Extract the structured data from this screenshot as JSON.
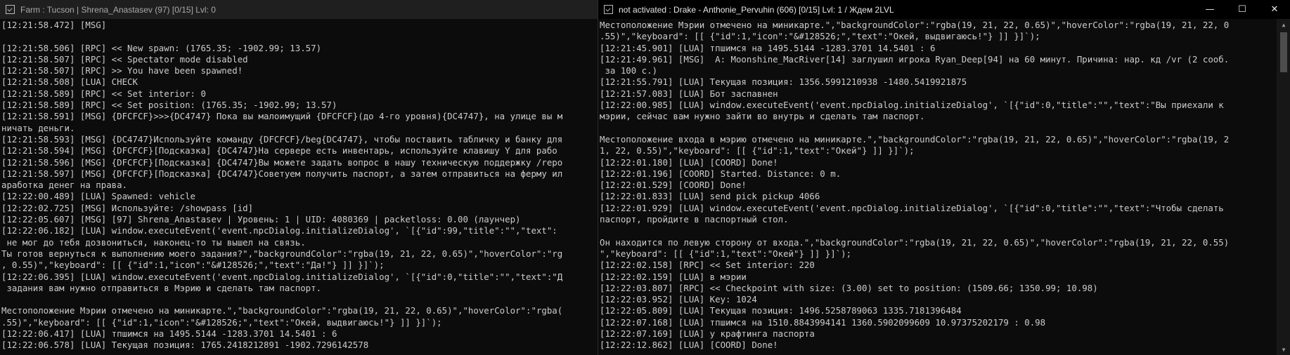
{
  "left_window": {
    "title": "Farm : Tucson | Shrena_Anastasev (97) [0/15] Lvl: 0",
    "lines": [
      "[12:21:58.472] [MSG]",
      "",
      "[12:21:58.506] [RPC] << New spawn: (1765.35; -1902.99; 13.57)",
      "[12:21:58.507] [RPC] << Spectator mode disabled",
      "[12:21:58.507] [RPC] >> You have been spawned!",
      "[12:21:58.508] [LUA] CHECK",
      "[12:21:58.589] [RPC] << Set interior: 0",
      "[12:21:58.589] [RPC] << Set position: (1765.35; -1902.99; 13.57)",
      "[12:21:58.591] [MSG] {DFCFCF}>>>{DC4747} Пока вы малоимущий {DFCFCF}(до 4-го уровня){DC4747}, на улице вы м",
      "ничать деньги.",
      "[12:21:58.593] [MSG] {DC4747}Используйте команду {DFCFCF}/beg{DC4747}, чтобы поставить табличку и банку для",
      "[12:21:58.594] [MSG] {DFCFCF}[Подсказка] {DC4747}На сервере есть инвентарь, используйте клавишу Y для рабо",
      "[12:21:58.596] [MSG] {DFCFCF}[Подсказка] {DC4747}Вы можете задать вопрос в нашу техническую поддержку /repo",
      "[12:21:58.597] [MSG] {DFCFCF}[Подсказка] {DC4747}Советуем получить паспорт, а затем отправиться на ферму ил",
      "аработка денег на права.",
      "[12:22:00.489] [LUA] Spawned: vehicle",
      "[12:22:02.725] [MSG] Используйте: /showpass [id]",
      "[12:22:05.607] [MSG] [97] Shrena_Anastasev | Уровень: 1 | UID: 4080369 | packetloss: 0.00 (лаунчер)",
      "[12:22:06.182] [LUA] window.executeEvent('event.npcDialog.initializeDialog', `[{\"id\":99,\"title\":\"\",\"text\":",
      " не мог до тебя дозвониться, наконец-то ты вышел на связь.",
      "Ты готов вернуться к выполнению моего задания?\",\"backgroundColor\":\"rgba(19, 21, 22, 0.65)\",\"hoverColor\":\"rg",
      ", 0.55)\",\"keyboard\": [[ {\"id\":1,\"icon\":\"&#128526;\",\"text\":\"Да!\"} ]] }]`);",
      "[12:22:06.395] [LUA] window.executeEvent('event.npcDialog.initializeDialog', `[{\"id\":0,\"title\":\"\",\"text\":\"Д",
      " задания вам нужно отправиться в Мэрию и сделать там паспорт.",
      "",
      "Местоположение Мэрии отмечено на миникарте.\",\"backgroundColor\":\"rgba(19, 21, 22, 0.65)\",\"hoverColor\":\"rgba(",
      ".55)\",\"keyboard\": [[ {\"id\":1,\"icon\":\"&#128526;\",\"text\":\"Окей, выдвигаюсь!\"} ]] }]`);",
      "[12:22:06.417] [LUA] тпшимся на 1495.5144 -1283.3701 14.5401 : 6",
      "[12:22:06.578] [LUA] Текущая позиция: 1765.2418212891 -1902.7296142578"
    ]
  },
  "right_window": {
    "title": "not activated : Drake - Anthonie_Pervuhin (606) [0/15] Lvl: 1 / Ждем 2LVL",
    "controls": {
      "minimize": "—",
      "maximize": "☐",
      "close": "✕"
    },
    "scroll_up": "▲",
    "scroll_down": "▼",
    "lines": [
      "Местоположение Мэрии отмечено на миникарте.\",\"backgroundColor\":\"rgba(19, 21, 22, 0.65)\",\"hoverColor\":\"rgba(19, 21, 22, 0",
      ".55)\",\"keyboard\": [[ {\"id\":1,\"icon\":\"&#128526;\",\"text\":\"Окей, выдвигаюсь!\"} ]] }]`);",
      "[12:21:45.901] [LUA] тпшимся на 1495.5144 -1283.3701 14.5401 : 6",
      "[12:21:49.961] [MSG]  A: Moonshine_MacRiver[14] заглушил игрока Ryan_Deep[94] на 60 минут. Причина: нар. кд /vr (2 сооб.",
      " за 100 с.)",
      "[12:21:55.791] [LUA] Текущая позиция: 1356.5991210938 -1480.5419921875",
      "[12:21:57.083] [LUA] Бот заспавнен",
      "[12:22:00.985] [LUA] window.executeEvent('event.npcDialog.initializeDialog', `[{\"id\":0,\"title\":\"\",\"text\":\"Вы приехали к",
      "мэрии, сейчас вам нужно зайти во внутрь и сделать там паспорт.",
      "",
      "Местоположение входа в мэрию отмечено на миникарте.\",\"backgroundColor\":\"rgba(19, 21, 22, 0.65)\",\"hoverColor\":\"rgba(19, 2",
      "1, 22, 0.55)\",\"keyboard\": [[ {\"id\":1,\"text\":\"Окей\"} ]] }]`);",
      "[12:22:01.180] [LUA] [COORD] Done!",
      "[12:22:01.196] [COORD] Started. Distance: 0 m.",
      "[12:22:01.529] [COORD] Done!",
      "[12:22:01.833] [LUA] send pick pickup 4066",
      "[12:22:01.929] [LUA] window.executeEvent('event.npcDialog.initializeDialog', `[{\"id\":0,\"title\":\"\",\"text\":\"Чтобы сделать",
      "паспорт, пройдите в паспортный стол.",
      "",
      "Он находится по левую сторону от входа.\",\"backgroundColor\":\"rgba(19, 21, 22, 0.65)\",\"hoverColor\":\"rgba(19, 21, 22, 0.55)",
      "\",\"keyboard\": [[ {\"id\":1,\"text\":\"Окей\"} ]] }]`);",
      "[12:22:02.158] [RPC] << Set interior: 220",
      "[12:22:02.159] [LUA] в мэрии",
      "[12:22:03.807] [RPC] << Checkpoint with size: (3.00) set to position: (1509.66; 1350.99; 10.98)",
      "[12:22:03.952] [LUA] Key: 1024",
      "[12:22:05.809] [LUA] Текущая позиция: 1496.5258789063 1335.7181396484",
      "[12:22:07.168] [LUA] тпшимся на 1510.8843994141 1360.5902099609 10.97375202179 : 0.98",
      "[12:22:07.169] [LUA] у крафтинга паспорта",
      "[12:22:12.862] [LUA] [COORD] Done!"
    ]
  }
}
